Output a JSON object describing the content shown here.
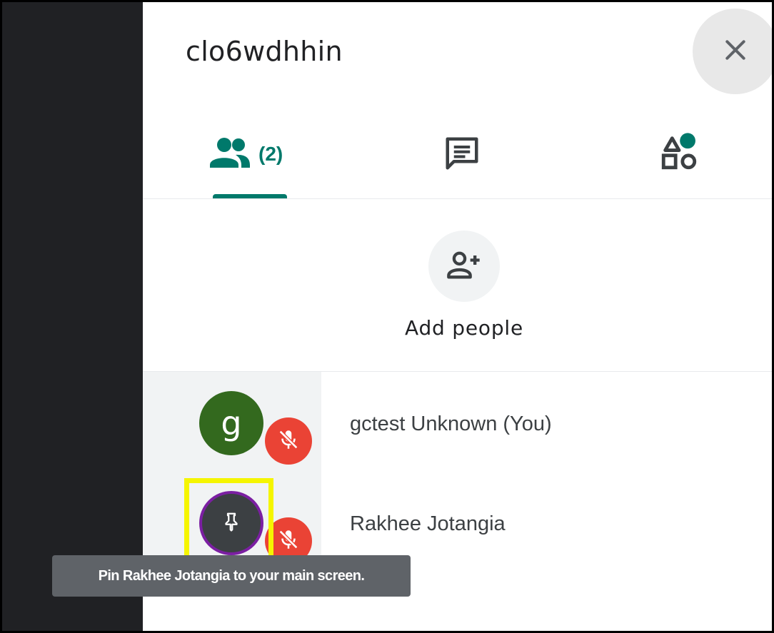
{
  "meeting": {
    "title": "clo6wdhhin"
  },
  "header": {
    "close_icon": "close-icon"
  },
  "tabs": {
    "people": {
      "icon": "people-icon",
      "count": "(2)",
      "selected": true
    },
    "chat": {
      "icon": "chat-icon"
    },
    "activities": {
      "icon": "activities-icon",
      "badge_color": "#00796b"
    }
  },
  "add_people": {
    "label": "Add people",
    "icon": "person-add-icon"
  },
  "participants": [
    {
      "name": "gctest Unknown (You)",
      "avatar_letter": "g",
      "avatar_color": "#33691e",
      "mic": "mic-off-icon"
    },
    {
      "name": "Rakhee Jotangia",
      "hover_icon": "pin-icon",
      "mic": "mic-off-icon"
    }
  ],
  "tooltip": {
    "text": "Pin Rakhee Jotangia to your main screen."
  },
  "colors": {
    "accent": "#00796b",
    "mic_off": "#ea4335",
    "highlight": "#f5f500",
    "sidebar_dark": "#202124"
  }
}
